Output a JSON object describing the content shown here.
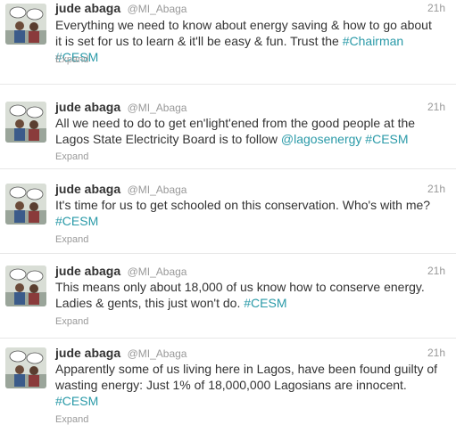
{
  "colors": {
    "link": "#2a9aa8",
    "muted": "#999999",
    "text": "#333333"
  },
  "tweets": [
    {
      "name": "jude abaga",
      "handle": "@MI_Abaga",
      "time": "21h",
      "text": "Everything we need to know about energy saving & how to go about it is set for us to learn & it'll be easy & fun. Trust the ",
      "link": "#Chairman",
      "text2": " ",
      "link2": "#CESM",
      "expand": "Expand"
    },
    {
      "name": "jude abaga",
      "handle": "@MI_Abaga",
      "time": "21h",
      "text": "All we need to do to get en'light'ened from the good people at the Lagos State Electricity Board is to follow ",
      "link": "@lagosenergy",
      "text2": " ",
      "link2": "#CESM",
      "expand": "Expand"
    },
    {
      "name": "jude abaga",
      "handle": "@MI_Abaga",
      "time": "21h",
      "text": "It's time for us to get schooled on this conservation. Who's with me? ",
      "link": "#CESM",
      "text2": "",
      "link2": "",
      "expand": "Expand"
    },
    {
      "name": "jude abaga",
      "handle": "@MI_Abaga",
      "time": "21h",
      "text": "This means only about 18,000 of us know how to conserve energy. Ladies & gents, this just won't do. ",
      "link": "#CESM",
      "text2": "",
      "link2": "",
      "expand": "Expand"
    },
    {
      "name": "jude abaga",
      "handle": "@MI_Abaga",
      "time": "21h",
      "text": "Apparently some of us living here in Lagos, have been found guilty of wasting energy: Just 1% of 18,000,000 Lagosians are innocent. ",
      "link": "#CESM",
      "text2": "",
      "link2": "",
      "expand": "Expand"
    }
  ]
}
